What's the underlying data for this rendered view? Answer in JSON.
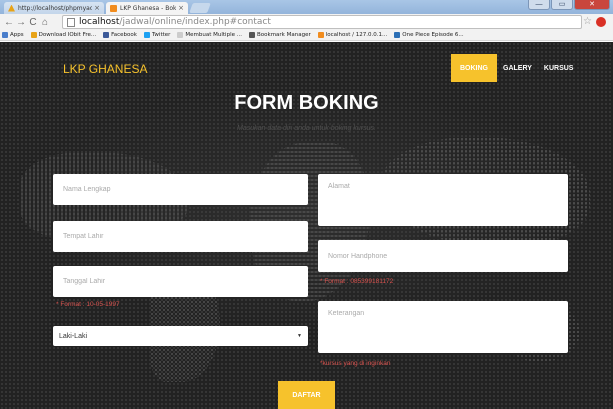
{
  "browser": {
    "tabs": [
      {
        "title": "http://localhost/phpmyad",
        "close": "×"
      },
      {
        "title": "LKP Ghanesa - Boking Or",
        "close": "×"
      }
    ],
    "window_controls": {
      "minimize": "—",
      "maximize": "▭",
      "close": "✕"
    },
    "nav": {
      "back": "←",
      "forward": "→",
      "reload": "C",
      "home": "⌂"
    },
    "url": {
      "host": "localhost",
      "path": "/jadwal/online/index.php#contact"
    },
    "bookmarks": [
      {
        "label": "Apps",
        "color": "#4a7ecb"
      },
      {
        "label": "Download IObit Fre...",
        "color": "#e8a317"
      },
      {
        "label": "Facebook",
        "color": "#3b5998"
      },
      {
        "label": "Twitter",
        "color": "#1da1f2"
      },
      {
        "label": "Membuat Multiple ...",
        "color": "#cccccc"
      },
      {
        "label": "Bookmark Manager",
        "color": "#555555"
      },
      {
        "label": "localhost / 127.0.0.1...",
        "color": "#f18c1e"
      },
      {
        "label": "One Piece Episode 6...",
        "color": "#2c6fb5"
      }
    ]
  },
  "site": {
    "brand": "LKP GHANESA",
    "menu": [
      "BOKING",
      "GALERY",
      "KURSUS"
    ],
    "accent": "#f6c22c"
  },
  "form": {
    "title": "FORM BOKING",
    "subtitle": "Masukan data diri anda untuk boking kursus.",
    "nama_placeholder": "Nama Lengkap",
    "tempat_placeholder": "Tempat Lahir",
    "tanggal_placeholder": "Tanggal Lahir",
    "tanggal_hint": "* Format : 10-05-1997",
    "gender_value": "Laki-Laki",
    "alamat_placeholder": "Alamat",
    "hp_placeholder": "Nomor Handphone",
    "hp_hint": "* Format : 085399181172",
    "keterangan_placeholder": "Keterangan",
    "keterangan_hint": "*kursus yang di inginkan",
    "submit_label": "DAFTAR"
  }
}
